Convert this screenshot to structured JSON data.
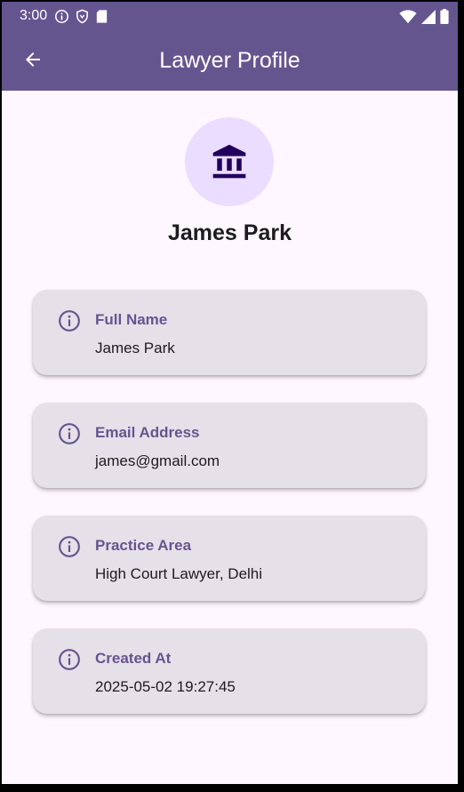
{
  "status_bar": {
    "time": "3:00",
    "icons_left": [
      "info-icon",
      "shield-icon",
      "sd-card-icon"
    ],
    "icons_right": [
      "wifi-icon",
      "signal-icon",
      "battery-icon"
    ]
  },
  "app_bar": {
    "title": "Lawyer Profile",
    "back_icon": "arrow-back-icon",
    "color": "#65558F"
  },
  "profile": {
    "avatar_icon": "courthouse-icon",
    "name": "James Park"
  },
  "fields": [
    {
      "label": "Full Name",
      "value": "James Park",
      "icon": "info-icon"
    },
    {
      "label": "Email Address",
      "value": "james@gmail.com",
      "icon": "info-icon"
    },
    {
      "label": "Practice Area",
      "value": "High Court Lawyer, Delhi",
      "icon": "info-icon"
    },
    {
      "label": "Created At",
      "value": "2025-05-02 19:27:45",
      "icon": "info-icon"
    }
  ],
  "colors": {
    "accent": "#65558F",
    "background": "#FEF7FF",
    "card": "#E6E0E9",
    "avatar_bg": "#EADDFF"
  }
}
